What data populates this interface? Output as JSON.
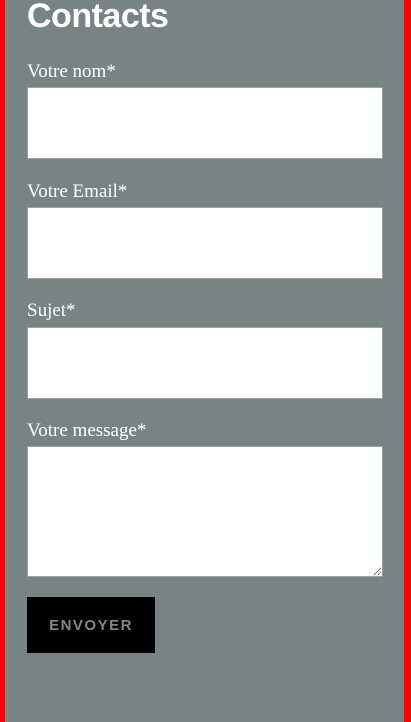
{
  "page": {
    "title": "Contacts"
  },
  "form": {
    "name_label": "Votre nom*",
    "name_value": "",
    "email_label": "Votre Email*",
    "email_value": "",
    "subject_label": "Sujet*",
    "subject_value": "",
    "message_label": "Votre message*",
    "message_value": "",
    "submit_label": "ENVOYER"
  },
  "colors": {
    "page_border": "#ff0000",
    "panel_background": "#778482",
    "button_background": "#000000",
    "button_text": "#7d8a88",
    "label_text": "#ffffff"
  }
}
